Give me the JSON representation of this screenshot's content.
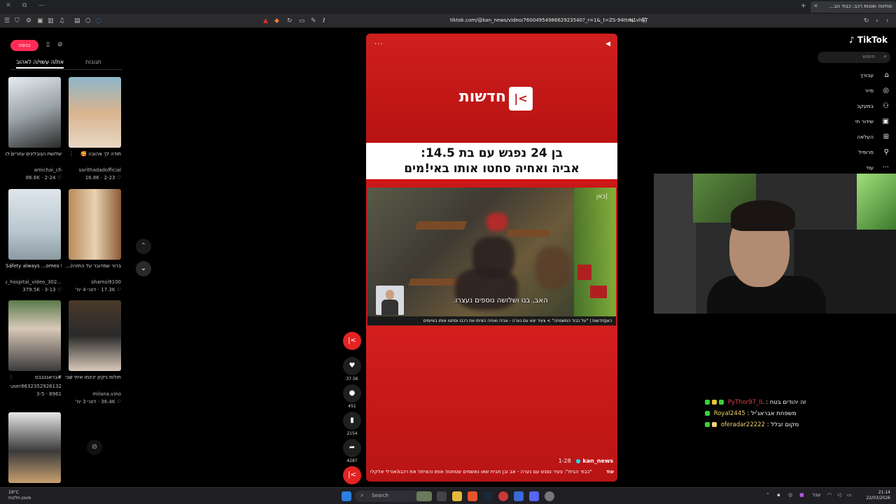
{
  "browser": {
    "tab_title": "סחיטה ואונות רכב: כבוד הב...",
    "url": "tiktok.com/@kan_news/video/760049549866292354​0?_r=1&_t=ZS-94ttrN1vhkT"
  },
  "left_panel": {
    "login_label": "כניסה",
    "tab_liked": "את/ה עשוי/ה לאהוב",
    "tab_comments": "תגובות",
    "videos": [
      {
        "caption": "שלושת הגובלינים עחרים לנסיכה לעשו...",
        "author": "amichai_ch",
        "date": "2-24",
        "views": "86.6K"
      },
      {
        "caption": "תודה לך אהובה 🥰",
        "author": "sarithadadofficial",
        "date": "2-23",
        "views": "16.8K"
      },
      {
        "caption": "Safety always ...omes first in MRI",
        "author": "...tv_hospital_video_302",
        "date": "3-13",
        "views": "379.5K"
      },
      {
        "caption": "ברור שמדובר על החזרה... #foryou#",
        "author": "shamsi9100",
        "date": "לפני 4 ימ'",
        "views": "17.3K"
      },
      {
        "caption": "#בראבנבבס",
        "author": "user8632352926132",
        "date": "3-5",
        "views": "8961"
      },
      {
        "caption": "חולות ניקיון יכינמו איתי שביד טוטס זה...",
        "author": "milana.vino",
        "date": "לפני 3 ימ'",
        "views": "36.4K"
      }
    ]
  },
  "video": {
    "brand": "חדשות",
    "brand_mark": "|<",
    "headline_l1": "בן 24 נפגש עם בת 14.5:",
    "headline_l2": "אביה ואחיה סחטו אותו באי!מים",
    "subtitle": "האב, בנו ושלושה נוספים נעצרו.",
    "watermark": "כאן|",
    "ticker": "כאן|חדשות | \"על כבוד המשפחה\" > צעיר יצא עם נערה - אביה ואחיה הציתו את רכבו וסחטו אותו באיומים",
    "author": "kan_news",
    "date": "1-28",
    "description": "\"כבוד הבית\": צעיר נפגש עם נערה - אב ובן חבית שאו נאשמים שסחטו! אותו והציתו! את רכבו(אורלי אלקלעי)",
    "more": "עוד"
  },
  "actions": {
    "likes": "37.5K",
    "comments": "451",
    "saves": "2154",
    "shares": "4287"
  },
  "right_nav": {
    "brand": "TikTok",
    "search_placeholder": "חיפוש",
    "items": [
      {
        "label": "עבורך",
        "icon": "home-icon"
      },
      {
        "label": "סייר",
        "icon": "compass-icon"
      },
      {
        "label": "במעקב",
        "icon": "following-icon"
      },
      {
        "label": "שידור חי",
        "icon": "live-icon"
      },
      {
        "label": "העלאה",
        "icon": "upload-icon"
      },
      {
        "label": "פרופיל",
        "icon": "profile-icon"
      },
      {
        "label": "עוד",
        "icon": "more-icon"
      }
    ]
  },
  "chat": [
    {
      "user": "PyThor97_IL",
      "user_color": "#e0424b",
      "message": "זה יהודים בטח"
    },
    {
      "user": "Royal2445",
      "user_color": "#f2d16b",
      "message": "משפחת אבראג'יל"
    },
    {
      "user": "oferadar22222",
      "user_color": "#f2d16b",
      "message": "מקום זבלל"
    }
  ],
  "taskbar": {
    "search": "Search",
    "weather_temp": "19°C",
    "weather_desc": "מעונן חלקית",
    "time": "21:14",
    "date": "22/03/2026",
    "lang": "עבר"
  }
}
